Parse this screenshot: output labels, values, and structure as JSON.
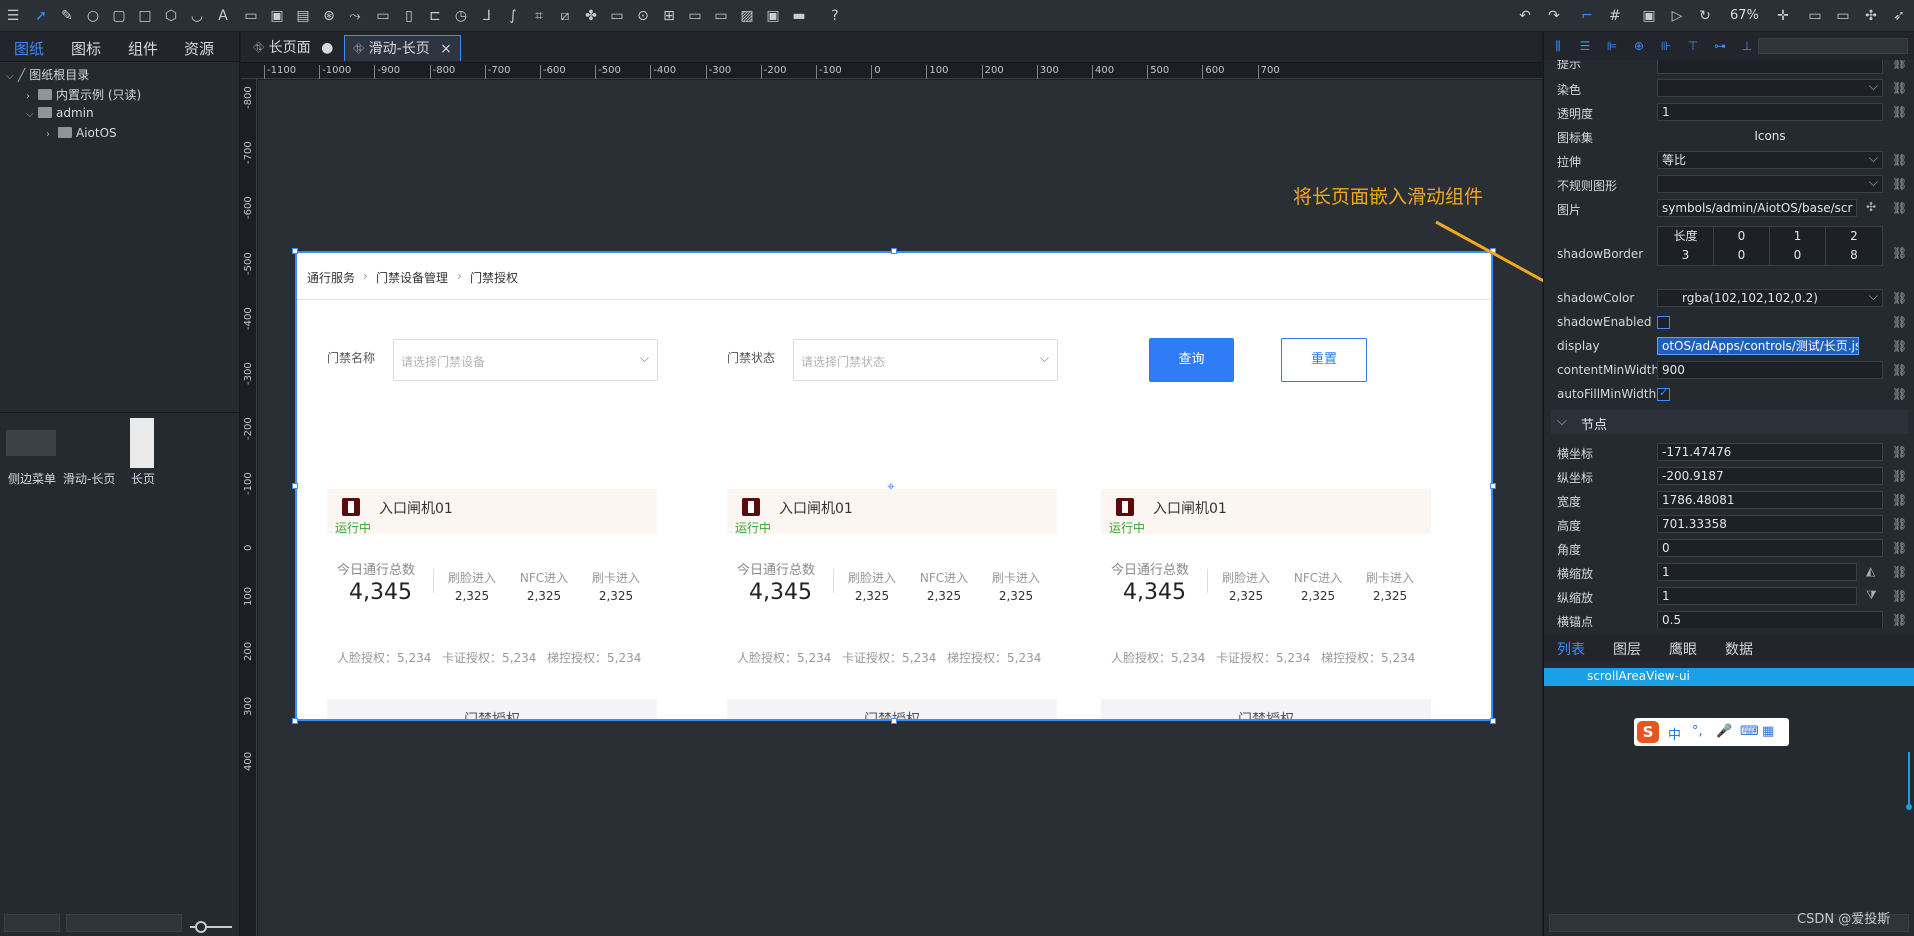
{
  "toolbar": {
    "zoom": "67%"
  },
  "left": {
    "tabs": [
      "图纸",
      "图标",
      "组件",
      "资源"
    ],
    "tree": [
      "图纸根目录",
      "内置示例 (只读)",
      "admin",
      "AiotOS"
    ],
    "thumbs": [
      "侧边菜单",
      "滑动-长页",
      "长页"
    ]
  },
  "doctabs": [
    {
      "label": "长页面"
    },
    {
      "label": "滑动-长页"
    }
  ],
  "ruler": {
    "h": [
      "-1100",
      "-1000",
      "-900",
      "-800",
      "-700",
      "-600",
      "-500",
      "-400",
      "-300",
      "-200",
      "-100",
      "0",
      "100",
      "200",
      "300",
      "400",
      "500",
      "600",
      "700"
    ],
    "v": [
      "-800",
      "-700",
      "-600",
      "-500",
      "-400",
      "-300",
      "-200",
      "-100",
      "0",
      "100",
      "200",
      "300",
      "400"
    ]
  },
  "artboard": {
    "breadcrumb": [
      "通行服务",
      "门禁设备管理",
      "门禁授权"
    ],
    "filter1": {
      "label": "门禁名称",
      "placeholder": "请选择门禁设备"
    },
    "filter2": {
      "label": "门禁状态",
      "placeholder": "请选择门禁状态"
    },
    "btn_query": "查询",
    "btn_reset": "重置",
    "cards": [
      {
        "name": "入口闸机01",
        "status": "运行中",
        "total_label": "今日通行总数",
        "total": "4,345",
        "face_label": "刷脸进入",
        "face": "2,325",
        "nfc_label": "NFC进入",
        "nfc": "2,325",
        "card_label": "刷卡进入",
        "card": "2,325",
        "auth_face": "人脸授权：5,234",
        "auth_card": "卡证授权：5,234",
        "auth_ladder": "梯控授权：5,234",
        "foot": "门禁授权"
      },
      {
        "name": "入口闸机01",
        "status": "运行中",
        "total_label": "今日通行总数",
        "total": "4,345",
        "face_label": "刷脸进入",
        "face": "2,325",
        "nfc_label": "NFC进入",
        "nfc": "2,325",
        "card_label": "刷卡进入",
        "card": "2,325",
        "auth_face": "人脸授权：5,234",
        "auth_card": "卡证授权：5,234",
        "auth_ladder": "梯控授权：5,234",
        "foot": "门禁授权"
      },
      {
        "name": "入口闸机01",
        "status": "运行中",
        "total_label": "今日通行总数",
        "total": "4,345",
        "face_label": "刷脸进入",
        "face": "2,325",
        "nfc_label": "NFC进入",
        "nfc": "2,325",
        "card_label": "刷卡进入",
        "card": "2,325",
        "auth_face": "人脸授权：5,234",
        "auth_card": "卡证授权：5,234",
        "auth_ladder": "梯控授权：5,234",
        "foot": "门禁授权"
      }
    ]
  },
  "annotation": "将长页面嵌入滑动组件",
  "props": {
    "top_label": "提示",
    "rows": [
      {
        "label": "染色",
        "value": "",
        "type": "select"
      },
      {
        "label": "透明度",
        "value": "1",
        "type": "input"
      },
      {
        "label": "图标集",
        "value": "Icons",
        "type": "center"
      },
      {
        "label": "拉伸",
        "value": "等比",
        "type": "select"
      },
      {
        "label": "不规则图形",
        "value": "",
        "type": "select"
      },
      {
        "label": "图片",
        "value": "symbols/admin/AiotOS/base/scr",
        "type": "narrow"
      }
    ],
    "shadowBorder": {
      "label": "shadowBorder",
      "row1": [
        "长度",
        "0",
        "1",
        "2"
      ],
      "row2": [
        "3",
        "0",
        "0",
        "8"
      ]
    },
    "rows2": [
      {
        "label": "shadowColor",
        "value": "rgba(102,102,102,0.2)",
        "type": "select"
      },
      {
        "label": "shadowEnabled",
        "value": "",
        "type": "checkbox"
      },
      {
        "label": "display",
        "value": "otOS/adApps/controls/测试/长页.json",
        "type": "hl"
      },
      {
        "label": "contentMinWidth",
        "value": "900",
        "type": "input"
      },
      {
        "label": "autoFillMinWidth",
        "value": "",
        "type": "checkbox-on"
      }
    ],
    "section": "节点",
    "node_rows": [
      {
        "label": "横坐标",
        "value": "-171.47476"
      },
      {
        "label": "纵坐标",
        "value": "-200.9187"
      },
      {
        "label": "宽度",
        "value": "1786.48081"
      },
      {
        "label": "高度",
        "value": "701.33358"
      },
      {
        "label": "角度",
        "value": "0"
      },
      {
        "label": "横缩放",
        "value": "1"
      },
      {
        "label": "纵缩放",
        "value": "1"
      },
      {
        "label": "横锚点",
        "value": "0.5"
      }
    ]
  },
  "rtabs": [
    "列表",
    "图层",
    "鹰眼",
    "数据"
  ],
  "list_item": "scrollAreaView-ui",
  "ime": {
    "logo": "S",
    "items": [
      "中",
      "°,",
      "🎤",
      "⌨",
      "▦"
    ]
  },
  "watermark": "CSDN @爱投斯"
}
